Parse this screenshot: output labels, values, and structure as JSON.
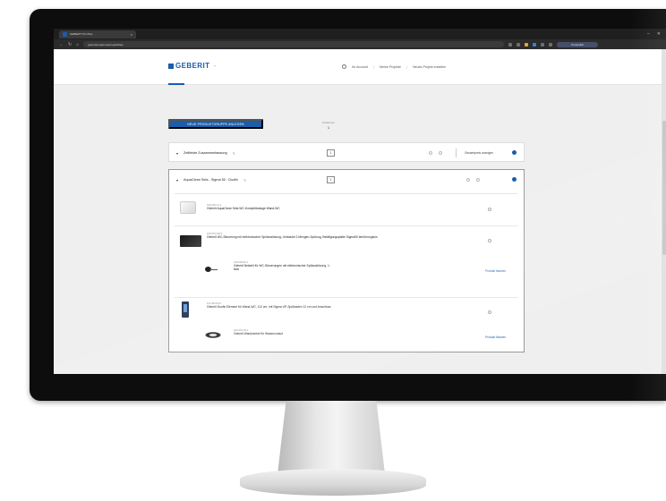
{
  "browser": {
    "tab_title": "GEBERIT Pro Plan",
    "tab_close": "×",
    "url": "geberitproplan.de/projekt/liste",
    "profile_label": "Persönlich"
  },
  "header": {
    "logo": "GEBERIT",
    "logo_tm": "™",
    "nav": [
      {
        "label": "Ihr Account"
      },
      {
        "label": "Meine Projekte"
      },
      {
        "label": "Neues Projekt erstellen"
      }
    ]
  },
  "toolbar": {
    "primary_label": "NEUE PRODUKTGRUPPE ANLEGEN",
    "count_label": "Positionen",
    "count_value": "1"
  },
  "section1": {
    "title": "Zeitleiste Zusammenfassung",
    "qty": "1",
    "right_label": "Gesamtpreis anzeigen"
  },
  "section2": {
    "title": "AquaClean Sela - Sigma 50 - Duofix",
    "qty": "1",
    "items": [
      {
        "code": "146.222.11.1",
        "name": "Geberit AquaClean Sela WC-Komplettanlage Wand-WC"
      },
      {
        "code": "115.670.DW.1",
        "name": "Geberit WC-Steuerung mit elektronischer Spülauslösung, Umbaukit 2-Mengen-Spülung, Betätigungsplatte Sigma50 berührungslos"
      },
      {
        "code": "115.635.00.1",
        "name": "Geberit Netzteil für WC-Steuerungen mit elektronischer Spülauslösung, 1-fach",
        "link": "Produkt löschen"
      },
      {
        "code": "111.300.00.5",
        "name": "Geberit Duofix Element für Wand-WC, 112 cm, mit Sigma UP-Spülkasten 12 cm und Anschluss"
      },
      {
        "code": "242.001.00.1",
        "name": "Geberit Wandwinkel für Wasserzulauf",
        "link": "Produkt löschen"
      }
    ]
  },
  "icons": {
    "chevron": "chevron-down-icon",
    "pencil": "pencil-icon",
    "info": "info-icon",
    "user": "user-icon"
  },
  "colors": {
    "brand": "#1b5da9"
  }
}
